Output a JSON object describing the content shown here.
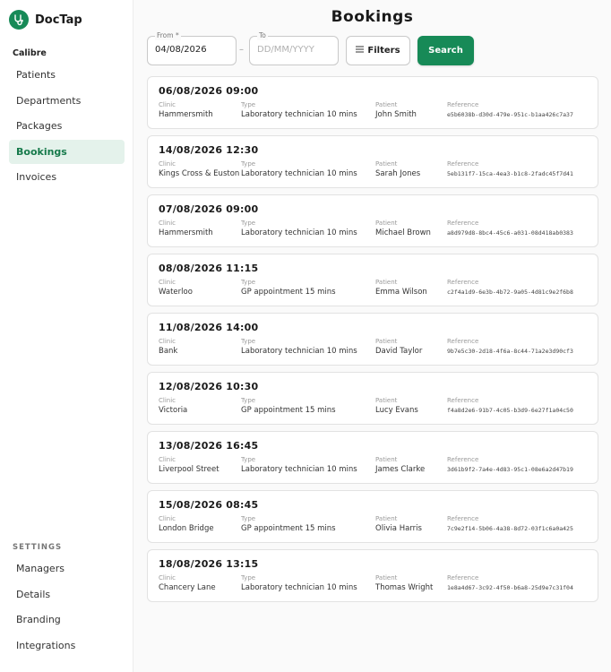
{
  "brand": {
    "name": "DocTap"
  },
  "org": {
    "name": "Calibre"
  },
  "nav": [
    {
      "label": "Patients",
      "active": false
    },
    {
      "label": "Departments",
      "active": false
    },
    {
      "label": "Packages",
      "active": false
    },
    {
      "label": "Bookings",
      "active": true
    },
    {
      "label": "Invoices",
      "active": false
    }
  ],
  "settings": {
    "label": "SETTINGS",
    "items": [
      {
        "label": "Managers"
      },
      {
        "label": "Details"
      },
      {
        "label": "Branding"
      },
      {
        "label": "Integrations"
      }
    ]
  },
  "page": {
    "title": "Bookings"
  },
  "filters": {
    "from_label": "From *",
    "from_value": "04/08/2026",
    "separator": "–",
    "to_label": "To",
    "to_placeholder": "DD/MM/YYYY",
    "filters_label": "Filters",
    "search_label": "Search"
  },
  "columns": {
    "clinic": "Clinic",
    "type": "Type",
    "patient": "Patient",
    "reference": "Reference"
  },
  "bookings": [
    {
      "datetime": "06/08/2026 09:00",
      "clinic": "Hammersmith",
      "type": "Laboratory technician 10 mins",
      "patient": "John Smith",
      "reference": "e5b6038b-d30d-479e-951c-b1aa426c7a37"
    },
    {
      "datetime": "14/08/2026 12:30",
      "clinic": "Kings Cross & Euston",
      "type": "Laboratory technician 10 mins",
      "patient": "Sarah Jones",
      "reference": "5eb131f7-15ca-4ea3-b1c8-2fadc45f7d41"
    },
    {
      "datetime": "07/08/2026 09:00",
      "clinic": "Hammersmith",
      "type": "Laboratory technician 10 mins",
      "patient": "Michael Brown",
      "reference": "a8d979d8-8bc4-45c6-a031-08d418ab0383"
    },
    {
      "datetime": "08/08/2026 11:15",
      "clinic": "Waterloo",
      "type": "GP appointment 15 mins",
      "patient": "Emma Wilson",
      "reference": "c2f4a1d9-6e3b-4b72-9a05-4d81c9e2f6b8"
    },
    {
      "datetime": "11/08/2026 14:00",
      "clinic": "Bank",
      "type": "Laboratory technician 10 mins",
      "patient": "David Taylor",
      "reference": "9b7e5c30-2d18-4f6a-8c44-71a2e3d90cf3"
    },
    {
      "datetime": "12/08/2026 10:30",
      "clinic": "Victoria",
      "type": "GP appointment 15 mins",
      "patient": "Lucy Evans",
      "reference": "f4a8d2e6-91b7-4c05-b3d9-6e27f1a04c50"
    },
    {
      "datetime": "13/08/2026 16:45",
      "clinic": "Liverpool Street",
      "type": "Laboratory technician 10 mins",
      "patient": "James Clarke",
      "reference": "3d61b9f2-7a4e-4d83-95c1-08e6a2d47b19"
    },
    {
      "datetime": "15/08/2026 08:45",
      "clinic": "London Bridge",
      "type": "GP appointment 15 mins",
      "patient": "Olivia Harris",
      "reference": "7c9e2f14-5b06-4a38-8d72-03f1c6a0a425"
    },
    {
      "datetime": "18/08/2026 13:15",
      "clinic": "Chancery Lane",
      "type": "Laboratory technician 10 mins",
      "patient": "Thomas Wright",
      "reference": "1e8a4d67-3c92-4f50-b6a8-25d9e7c31f04"
    }
  ],
  "icons": {
    "brand": "stethoscope-icon",
    "filters": "filter-lines-icon"
  },
  "colors": {
    "accent": "#178a57",
    "active_bg": "#e4f2eb",
    "active_text": "#167a4b"
  }
}
